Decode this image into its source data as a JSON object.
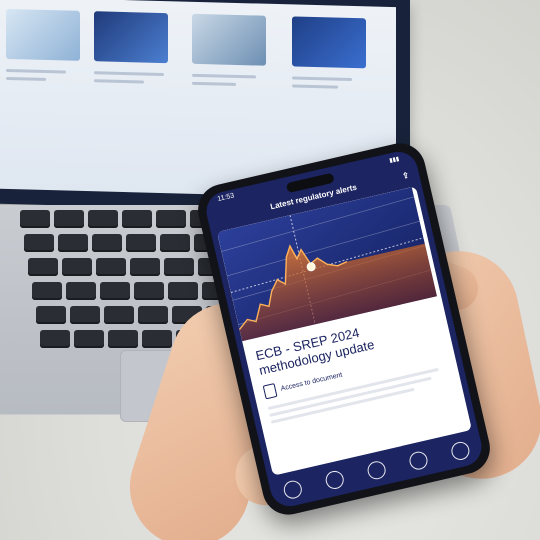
{
  "phone": {
    "status_time": "11:53",
    "header_title": "Latest regulatory alerts",
    "article": {
      "kicker": "",
      "headline": "ECB - SREP 2024 methodology update",
      "access_label": "Access to document"
    },
    "nav_icons": [
      "list-icon",
      "document-icon",
      "upload-icon",
      "edit-icon",
      "menu-icon"
    ]
  },
  "colors": {
    "app_navy": "#1c2461",
    "chart_line": "#f08a2a",
    "chart_bg": "#1b2a72"
  }
}
